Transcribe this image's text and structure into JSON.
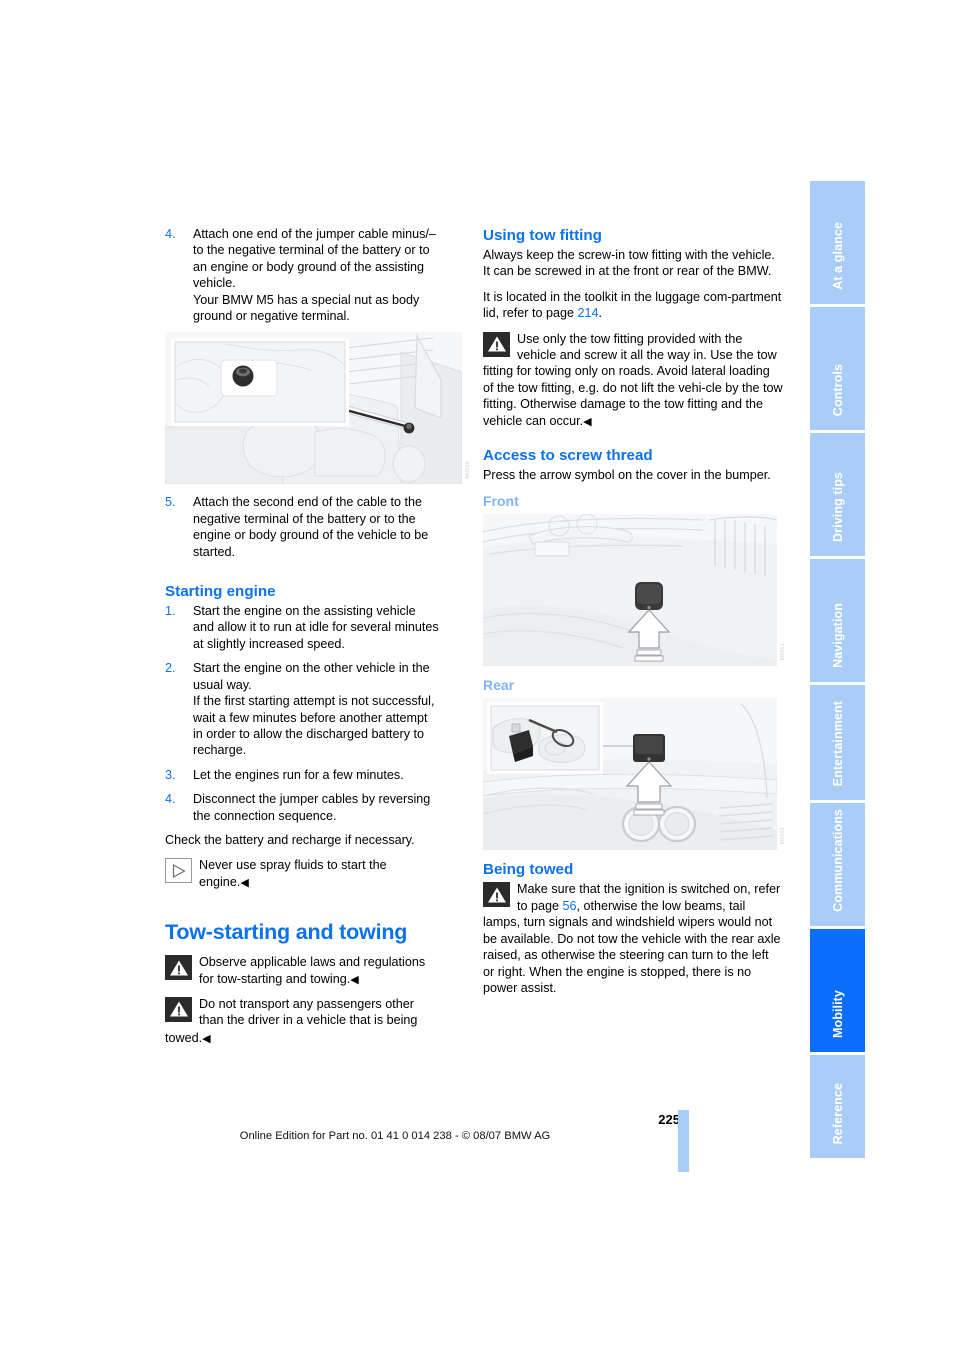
{
  "document": {
    "page_number": "225",
    "footer": "Online Edition for Part no. 01 41 0 014 238 - © 08/07 BMW AG"
  },
  "sidebar": {
    "tabs": [
      {
        "label": "At a glance",
        "active": false
      },
      {
        "label": "Controls",
        "active": false
      },
      {
        "label": "Driving tips",
        "active": false
      },
      {
        "label": "Navigation",
        "active": false
      },
      {
        "label": "Entertainment",
        "active": false
      },
      {
        "label": "Communications",
        "active": false
      },
      {
        "label": "Mobility",
        "active": true
      },
      {
        "label": "Reference",
        "active": false
      }
    ],
    "colors": {
      "inactive_bg": "#aaccf8",
      "active_bg": "#0b6efd",
      "label": "#ffffff"
    }
  },
  "colors": {
    "heading_blue": "#0b72ee",
    "subheading_blue": "#7fb4f5",
    "link_blue": "#0b72ee",
    "figure_bg": "#f7f8f9",
    "warning_icon_bg": "#2b2b2b"
  },
  "left_column": {
    "step4": {
      "num": "4.",
      "line1": "Attach one end of the jumper cable minus/–",
      "line2": "to the negative terminal of the battery or to",
      "line3": "an engine or body ground of the assisting",
      "line4": "vehicle.",
      "line5": "Your BMW M5 has a special nut as body",
      "line6": "ground or negative terminal."
    },
    "figure_battery_ground": {
      "name": "battery-ground-nut-engine-bay",
      "credit": "M0500"
    },
    "step5": {
      "num": "5.",
      "line1": "Attach the second end of the cable to the",
      "line2": "negative terminal of the battery or to the",
      "line3": "engine or body ground of the vehicle to be",
      "line4": "started."
    },
    "starting_engine": {
      "heading": "Starting engine",
      "steps": [
        {
          "num": "1.",
          "lines": [
            "Start the engine on the assisting vehicle",
            "and allow it to run at idle for several minutes",
            "at slightly increased speed."
          ]
        },
        {
          "num": "2.",
          "lines": [
            "Start the engine on the other vehicle in the",
            "usual way.",
            "If the first starting attempt is not successful,",
            "wait a few minutes before another attempt",
            "in order to allow the discharged battery to",
            "recharge."
          ]
        },
        {
          "num": "3.",
          "lines": [
            "Let the engines run for a few minutes."
          ]
        },
        {
          "num": "4.",
          "lines": [
            "Disconnect the jumper cables by reversing",
            "the connection sequence."
          ]
        }
      ],
      "closing": "Check the battery and recharge if necessary.",
      "tip": {
        "icon": "play-triangle-icon",
        "line1": "Never use spray fluids to start the",
        "line2": "engine.",
        "endmark": "◀"
      }
    },
    "tow_starting": {
      "heading": "Tow-starting and towing",
      "warning1": {
        "icon": "warning-triangle-icon",
        "line1": "Observe applicable laws and regulations",
        "line2": "for tow-starting and towing.",
        "endmark": "◀"
      },
      "warning2": {
        "icon": "warning-triangle-icon",
        "line1": "Do not transport any passengers other",
        "line2": "than the driver in a vehicle that is being",
        "line3": "towed.",
        "endmark": "◀"
      }
    }
  },
  "right_column": {
    "using_tow_fitting": {
      "heading": "Using tow fitting",
      "para1": "Always keep the screw-in tow fitting with the vehicle. It can be screwed in at the front or rear of the BMW.",
      "para2_a": "It is located in the toolkit in the luggage com-partment lid, refer to page ",
      "para2_link": "214",
      "para2_b": ".",
      "warning": {
        "icon": "warning-triangle-icon",
        "text": "Use only the tow fitting provided with the vehicle and screw it all the way in. Use the tow fitting for towing only on roads. Avoid lateral loading of the tow fitting, e.g. do not lift the vehi-cle by the tow fitting. Otherwise damage to the tow fitting and the vehicle can occur.",
        "endmark": "◀"
      }
    },
    "access_to_screw_thread": {
      "heading": "Access to screw thread",
      "para": "Press the arrow symbol on the cover in the bumper.",
      "front": {
        "label": "Front",
        "figure_name": "front-bumper-cover-arrow",
        "credit": "M0501"
      },
      "rear": {
        "label": "Rear",
        "figure_name": "rear-bumper-cover-arrow",
        "credit": "M0502"
      }
    },
    "being_towed": {
      "heading": "Being towed",
      "warning": {
        "icon": "warning-triangle-icon",
        "text_a": "Make sure that the ignition is switched on, refer to page ",
        "link": "56",
        "text_b": ", otherwise the low beams, tail lamps, turn signals and windshield wipers would not be available. Do not tow the vehicle with the rear axle raised, as otherwise the steering can turn to the left or right. When the engine is stopped, there is no power assist."
      }
    }
  }
}
